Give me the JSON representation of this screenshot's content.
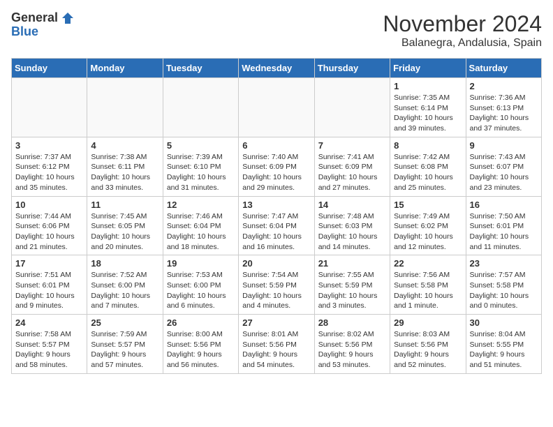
{
  "logo": {
    "line1": "General",
    "line2": "Blue"
  },
  "title": "November 2024",
  "location": "Balanegra, Andalusia, Spain",
  "days_header": [
    "Sunday",
    "Monday",
    "Tuesday",
    "Wednesday",
    "Thursday",
    "Friday",
    "Saturday"
  ],
  "weeks": [
    [
      {
        "day": "",
        "info": ""
      },
      {
        "day": "",
        "info": ""
      },
      {
        "day": "",
        "info": ""
      },
      {
        "day": "",
        "info": ""
      },
      {
        "day": "",
        "info": ""
      },
      {
        "day": "1",
        "info": "Sunrise: 7:35 AM\nSunset: 6:14 PM\nDaylight: 10 hours\nand 39 minutes."
      },
      {
        "day": "2",
        "info": "Sunrise: 7:36 AM\nSunset: 6:13 PM\nDaylight: 10 hours\nand 37 minutes."
      }
    ],
    [
      {
        "day": "3",
        "info": "Sunrise: 7:37 AM\nSunset: 6:12 PM\nDaylight: 10 hours\nand 35 minutes."
      },
      {
        "day": "4",
        "info": "Sunrise: 7:38 AM\nSunset: 6:11 PM\nDaylight: 10 hours\nand 33 minutes."
      },
      {
        "day": "5",
        "info": "Sunrise: 7:39 AM\nSunset: 6:10 PM\nDaylight: 10 hours\nand 31 minutes."
      },
      {
        "day": "6",
        "info": "Sunrise: 7:40 AM\nSunset: 6:09 PM\nDaylight: 10 hours\nand 29 minutes."
      },
      {
        "day": "7",
        "info": "Sunrise: 7:41 AM\nSunset: 6:09 PM\nDaylight: 10 hours\nand 27 minutes."
      },
      {
        "day": "8",
        "info": "Sunrise: 7:42 AM\nSunset: 6:08 PM\nDaylight: 10 hours\nand 25 minutes."
      },
      {
        "day": "9",
        "info": "Sunrise: 7:43 AM\nSunset: 6:07 PM\nDaylight: 10 hours\nand 23 minutes."
      }
    ],
    [
      {
        "day": "10",
        "info": "Sunrise: 7:44 AM\nSunset: 6:06 PM\nDaylight: 10 hours\nand 21 minutes."
      },
      {
        "day": "11",
        "info": "Sunrise: 7:45 AM\nSunset: 6:05 PM\nDaylight: 10 hours\nand 20 minutes."
      },
      {
        "day": "12",
        "info": "Sunrise: 7:46 AM\nSunset: 6:04 PM\nDaylight: 10 hours\nand 18 minutes."
      },
      {
        "day": "13",
        "info": "Sunrise: 7:47 AM\nSunset: 6:04 PM\nDaylight: 10 hours\nand 16 minutes."
      },
      {
        "day": "14",
        "info": "Sunrise: 7:48 AM\nSunset: 6:03 PM\nDaylight: 10 hours\nand 14 minutes."
      },
      {
        "day": "15",
        "info": "Sunrise: 7:49 AM\nSunset: 6:02 PM\nDaylight: 10 hours\nand 12 minutes."
      },
      {
        "day": "16",
        "info": "Sunrise: 7:50 AM\nSunset: 6:01 PM\nDaylight: 10 hours\nand 11 minutes."
      }
    ],
    [
      {
        "day": "17",
        "info": "Sunrise: 7:51 AM\nSunset: 6:01 PM\nDaylight: 10 hours\nand 9 minutes."
      },
      {
        "day": "18",
        "info": "Sunrise: 7:52 AM\nSunset: 6:00 PM\nDaylight: 10 hours\nand 7 minutes."
      },
      {
        "day": "19",
        "info": "Sunrise: 7:53 AM\nSunset: 6:00 PM\nDaylight: 10 hours\nand 6 minutes."
      },
      {
        "day": "20",
        "info": "Sunrise: 7:54 AM\nSunset: 5:59 PM\nDaylight: 10 hours\nand 4 minutes."
      },
      {
        "day": "21",
        "info": "Sunrise: 7:55 AM\nSunset: 5:59 PM\nDaylight: 10 hours\nand 3 minutes."
      },
      {
        "day": "22",
        "info": "Sunrise: 7:56 AM\nSunset: 5:58 PM\nDaylight: 10 hours\nand 1 minute."
      },
      {
        "day": "23",
        "info": "Sunrise: 7:57 AM\nSunset: 5:58 PM\nDaylight: 10 hours\nand 0 minutes."
      }
    ],
    [
      {
        "day": "24",
        "info": "Sunrise: 7:58 AM\nSunset: 5:57 PM\nDaylight: 9 hours\nand 58 minutes."
      },
      {
        "day": "25",
        "info": "Sunrise: 7:59 AM\nSunset: 5:57 PM\nDaylight: 9 hours\nand 57 minutes."
      },
      {
        "day": "26",
        "info": "Sunrise: 8:00 AM\nSunset: 5:56 PM\nDaylight: 9 hours\nand 56 minutes."
      },
      {
        "day": "27",
        "info": "Sunrise: 8:01 AM\nSunset: 5:56 PM\nDaylight: 9 hours\nand 54 minutes."
      },
      {
        "day": "28",
        "info": "Sunrise: 8:02 AM\nSunset: 5:56 PM\nDaylight: 9 hours\nand 53 minutes."
      },
      {
        "day": "29",
        "info": "Sunrise: 8:03 AM\nSunset: 5:56 PM\nDaylight: 9 hours\nand 52 minutes."
      },
      {
        "day": "30",
        "info": "Sunrise: 8:04 AM\nSunset: 5:55 PM\nDaylight: 9 hours\nand 51 minutes."
      }
    ]
  ]
}
